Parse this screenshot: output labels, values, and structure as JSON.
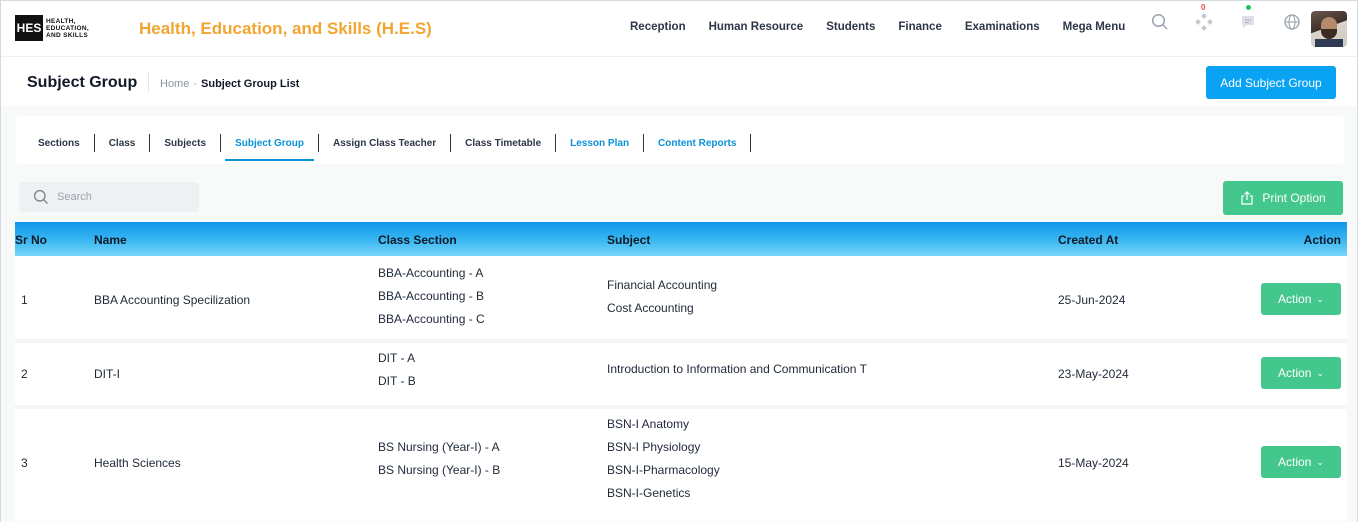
{
  "brand": {
    "logo_abbr": "HES",
    "logo_line1": "HEALTH,",
    "logo_line2": "EDUCATION,",
    "logo_line3": "AND SKILLS",
    "app_title": "Health, Education, and Skills (H.E.S)"
  },
  "topnav": [
    "Reception",
    "Human Resource",
    "Students",
    "Finance",
    "Examinations",
    "Mega Menu"
  ],
  "top_icons": {
    "search": "search-icon",
    "apps": "apps-icon",
    "apps_badge": "0",
    "messages": "chat-icon",
    "language": "globe-icon",
    "avatar": "user-avatar"
  },
  "header": {
    "title": "Subject Group",
    "breadcrumb_home": "Home",
    "breadcrumb_sep": "-",
    "breadcrumb_current": "Subject Group List",
    "add_button": "Add Subject Group"
  },
  "tabs": [
    {
      "label": "Sections",
      "state": "normal"
    },
    {
      "label": "Class",
      "state": "normal"
    },
    {
      "label": "Subjects",
      "state": "normal"
    },
    {
      "label": "Subject Group",
      "state": "active"
    },
    {
      "label": "Assign Class Teacher",
      "state": "normal"
    },
    {
      "label": "Class Timetable",
      "state": "normal"
    },
    {
      "label": "Lesson Plan",
      "state": "blue"
    },
    {
      "label": "Content Reports",
      "state": "blue"
    }
  ],
  "toolbar": {
    "search_placeholder": "Search",
    "print_label": "Print Option"
  },
  "table": {
    "columns": [
      "Sr No",
      "Name",
      "Class Section",
      "Subject",
      "Created At",
      "Action"
    ],
    "rows": [
      {
        "sr": "1",
        "name": "BBA Accounting Specilization",
        "sections": [
          "BBA-Accounting - A",
          "BBA-Accounting - B",
          "BBA-Accounting - C"
        ],
        "subjects": [
          "Financial Accounting",
          "Cost Accounting"
        ],
        "created": "25-Jun-2024",
        "action": "Action"
      },
      {
        "sr": "2",
        "name": "DIT-I",
        "sections": [
          "DIT - A",
          "DIT - B"
        ],
        "subjects": [
          "Introduction to Information and Communication T"
        ],
        "created": "23-May-2024",
        "action": "Action"
      },
      {
        "sr": "3",
        "name": "Health Sciences",
        "sections": [
          "BS Nursing (Year-I) - A",
          "BS Nursing (Year-I) - B"
        ],
        "subjects": [
          "BSN-I Anatomy",
          "BSN-I Physiology",
          "BSN-I-Pharmacology",
          "BSN-I-Genetics"
        ],
        "created": "15-May-2024",
        "action": "Action"
      }
    ]
  },
  "colors": {
    "accent": "#0aa2f2",
    "brand_title": "#f2a531",
    "success": "#43c78c"
  }
}
